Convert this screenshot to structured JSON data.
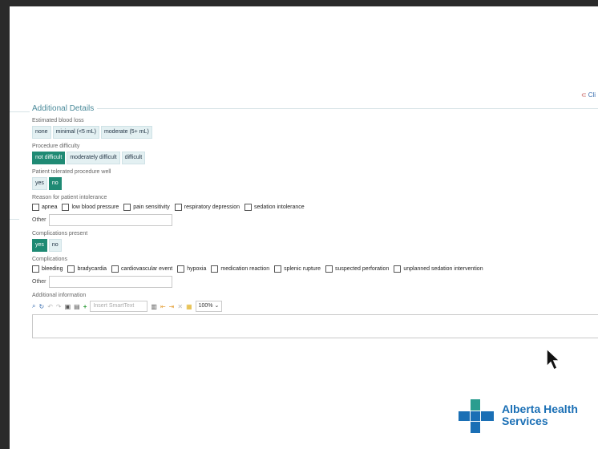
{
  "header": {
    "clip_link": "Cli"
  },
  "section_title": "Additional Details",
  "blood_loss": {
    "label": "Estimated blood loss",
    "options": [
      "none",
      "minimal (<5 mL)",
      "moderate (5+ mL)"
    ],
    "selected": null
  },
  "difficulty": {
    "label": "Procedure difficulty",
    "options": [
      "not difficult",
      "moderately difficult",
      "difficult"
    ],
    "selected": 0
  },
  "tolerated": {
    "label": "Patient tolerated procedure well",
    "options": [
      "yes",
      "no"
    ],
    "selected": 1
  },
  "intolerance": {
    "label": "Reason for patient intolerance",
    "options": [
      "apnea",
      "low blood pressure",
      "pain sensitivity",
      "respiratory depression",
      "sedation intolerance"
    ],
    "other_label": "Other"
  },
  "complications_present": {
    "label": "Complications present",
    "options": [
      "yes",
      "no"
    ],
    "selected": 0
  },
  "complications": {
    "label": "Complications",
    "options": [
      "bleeding",
      "bradycardia",
      "cardiovascular event",
      "hypoxia",
      "medication reaction",
      "splenic rupture",
      "suspected perforation",
      "unplanned sedation intervention"
    ],
    "other_label": "Other"
  },
  "additional_info": {
    "label": "Additional information",
    "smarttext_placeholder": "Insert SmartText",
    "zoom": "100%"
  },
  "logo": {
    "line1": "Alberta Health",
    "line2": "Services"
  },
  "colors": {
    "selected": "#1f8a74",
    "option_bg": "#e3f0f2",
    "logo_blue": "#1a6fb5",
    "logo_green": "#2a9d8f"
  }
}
